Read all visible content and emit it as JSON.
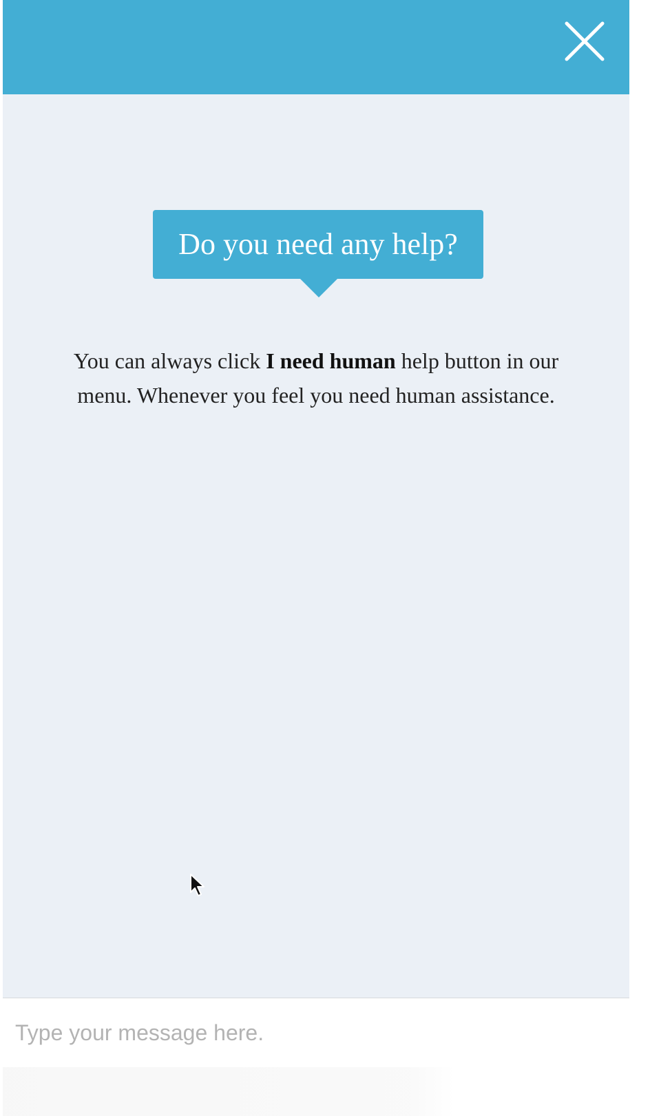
{
  "header": {
    "close_icon": "close-icon",
    "background_color": "#43aed4"
  },
  "chat": {
    "bubble_text": "Do you need any help?",
    "info_prefix": "You can always click ",
    "info_bold": "I need human",
    "info_suffix": " help button in our menu. Whenever you feel you need human assistance.",
    "background_color": "#ebf0f6"
  },
  "composer": {
    "placeholder": "Type your message here.",
    "value": ""
  }
}
